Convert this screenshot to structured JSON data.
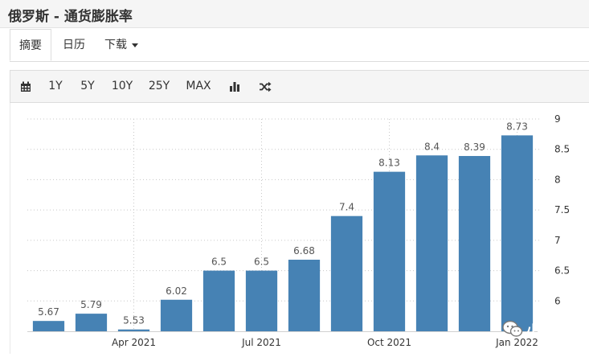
{
  "page": {
    "title": "俄罗斯 - 通货膨胀率"
  },
  "tabs": [
    {
      "label": "摘要",
      "active": true
    },
    {
      "label": "日历"
    },
    {
      "label": "下载"
    }
  ],
  "toolbar": {
    "calendar_icon": "calendar-icon",
    "ranges": [
      "1Y",
      "5Y",
      "10Y",
      "25Y",
      "MAX"
    ],
    "bar_chart_icon": "bar-chart-icon",
    "shuffle_icon": "shuffle-icon"
  },
  "colors": {
    "bar": "#4682b4",
    "grid": "#c8c8c8",
    "toolbar_bg": "#f5f5f5"
  },
  "watermark": {
    "text": "小妙说",
    "icon": "wechat-icon"
  },
  "chart_data": {
    "type": "bar",
    "categories": [
      "2021-02",
      "2021-03",
      "2021-04",
      "2021-05",
      "2021-06",
      "2021-07",
      "2021-08",
      "2021-09",
      "2021-10",
      "2021-11",
      "2021-12",
      "2022-01"
    ],
    "values": [
      5.67,
      5.79,
      5.53,
      6.02,
      6.5,
      6.5,
      6.68,
      7.4,
      8.13,
      8.4,
      8.39,
      8.73
    ],
    "data_labels": [
      "5.67",
      "5.79",
      "5.53",
      "6.02",
      "6.5",
      "6.5",
      "6.68",
      "7.4",
      "8.13",
      "8.4",
      "8.39",
      "8.73"
    ],
    "x_tick_labels": [
      {
        "label": "Apr 2021",
        "category": "2021-04"
      },
      {
        "label": "Jul 2021",
        "category": "2021-07"
      },
      {
        "label": "Oct 2021",
        "category": "2021-10"
      },
      {
        "label": "Jan 2022",
        "category": "2022-01"
      }
    ],
    "y_ticks": [
      6,
      6.5,
      7,
      7.5,
      8,
      8.5,
      9
    ],
    "y_tick_labels": [
      "6",
      "6.5",
      "7",
      "7.5",
      "8",
      "8.5",
      "9"
    ],
    "ylim": [
      5.5,
      9
    ],
    "y_axis_position": "right",
    "grid": true,
    "title": "",
    "xlabel": "",
    "ylabel": ""
  }
}
